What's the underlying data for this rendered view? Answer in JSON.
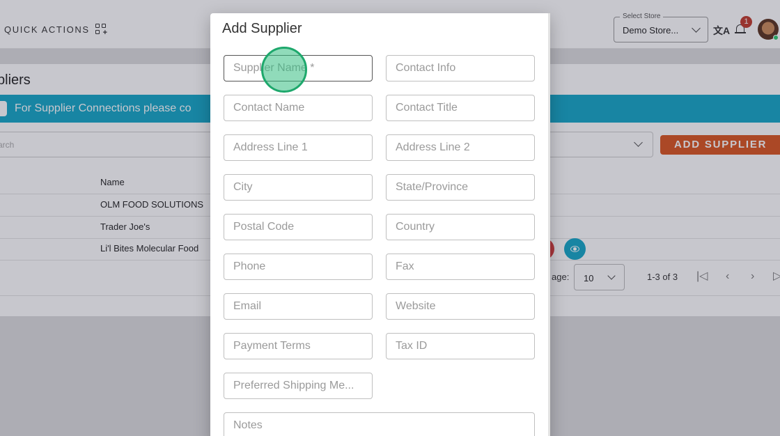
{
  "header": {
    "quick_actions": "QUICK ACTIONS",
    "store_select_label": "Select Store",
    "store_select_value": "Demo Store...",
    "translate_icon": "文A",
    "notification_count": "1"
  },
  "page": {
    "title": "Suppliers",
    "title_visible": "pliers",
    "banner_text": "For Supplier Connections please co",
    "search_placeholder": "Search",
    "search_placeholder_visible": "arch",
    "add_button": "ADD SUPPLIER",
    "table": {
      "columns": [
        "Name"
      ],
      "rows": [
        "OLM FOOD SOLUTIONS",
        "Trader Joe's",
        "Li'l Bites Molecular Food"
      ]
    },
    "rows_per_page_label": "age:",
    "rows_per_page_value": "10",
    "range_text": "1-3 of 3"
  },
  "modal": {
    "title": "Add Supplier",
    "fields": {
      "supplier_name": "Supplier Name *",
      "contact_info": "Contact Info",
      "contact_name": "Contact Name",
      "contact_title": "Contact Title",
      "address_line_1": "Address Line 1",
      "address_line_2": "Address Line 2",
      "city": "City",
      "state_province": "State/Province",
      "postal_code": "Postal Code",
      "country": "Country",
      "phone": "Phone",
      "fax": "Fax",
      "email": "Email",
      "website": "Website",
      "payment_terms": "Payment Terms",
      "tax_id": "Tax ID",
      "preferred_shipping": "Preferred Shipping Me...",
      "notes": "Notes"
    }
  },
  "colors": {
    "banner": "#13a7c7",
    "add_button": "#d9541e",
    "click_marker": "#1ea86c"
  }
}
